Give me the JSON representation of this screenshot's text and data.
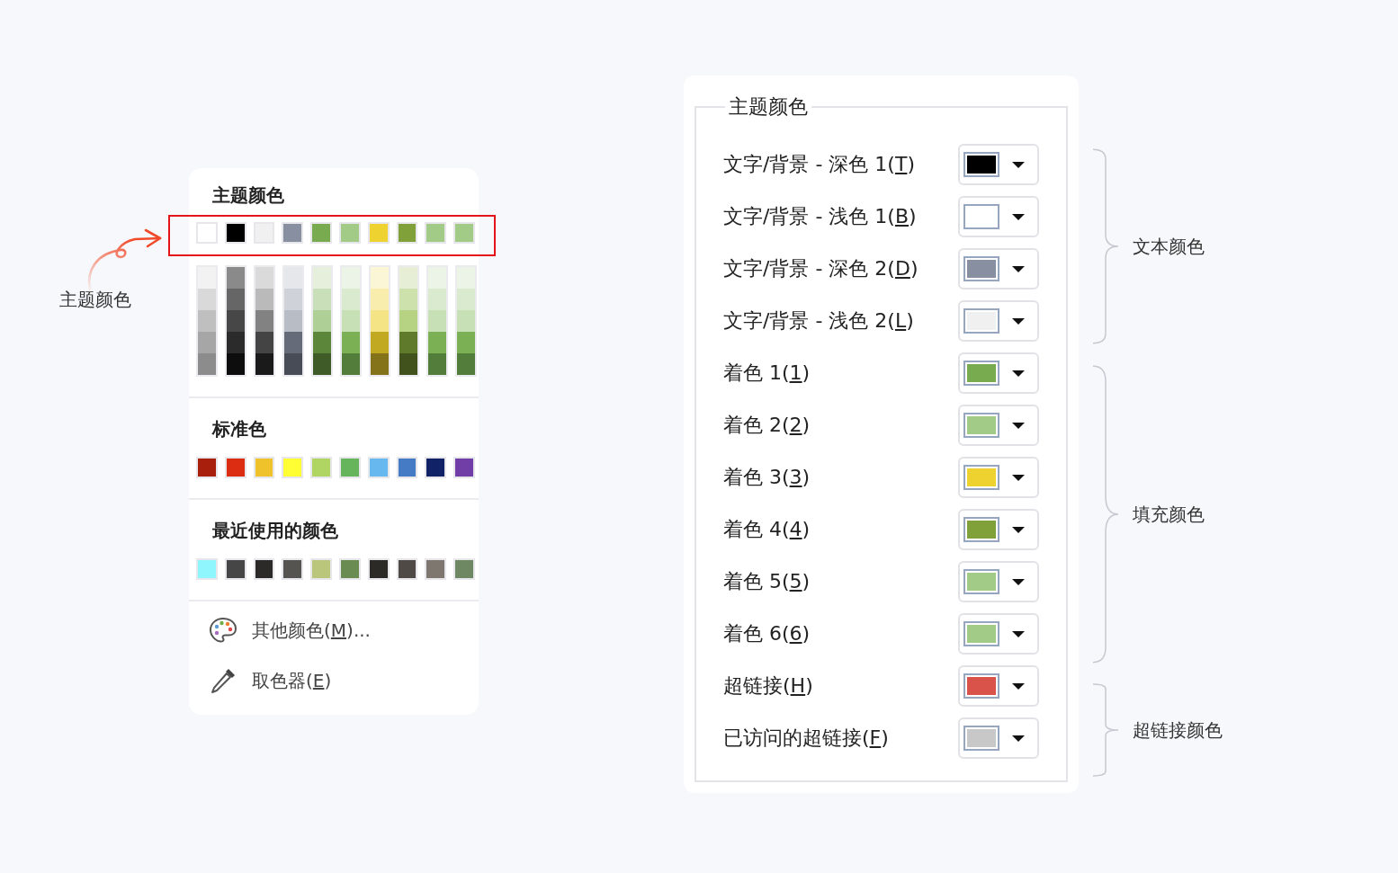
{
  "annotation": {
    "label": "主题颜色"
  },
  "color_menu": {
    "theme": {
      "title": "主题颜色",
      "highlighted": true,
      "swatches": [
        {
          "color": "#ffffff"
        },
        {
          "color": "#000000"
        },
        {
          "color": "#f0f0f0"
        },
        {
          "color": "#878fa0"
        },
        {
          "color": "#78ab50"
        },
        {
          "color": "#a1cb86"
        },
        {
          "color": "#eed230"
        },
        {
          "color": "#80a03a"
        },
        {
          "color": "#a1cb86"
        },
        {
          "color": "#a1cb86"
        }
      ],
      "shades": [
        {
          "cells": [
            {
              "color": "#f2f2f2"
            },
            {
              "color": "#d9d9d9"
            },
            {
              "color": "#bfbfbf"
            },
            {
              "color": "#a6a6a6"
            },
            {
              "color": "#8c8c8c"
            }
          ]
        },
        {
          "cells": [
            {
              "color": "#8a8a8a"
            },
            {
              "color": "#666666"
            },
            {
              "color": "#474747"
            },
            {
              "color": "#2b2b2b"
            },
            {
              "color": "#0d0d0d"
            }
          ]
        },
        {
          "cells": [
            {
              "color": "#dadada"
            },
            {
              "color": "#bababa"
            },
            {
              "color": "#828282"
            },
            {
              "color": "#444444"
            },
            {
              "color": "#1a1a1a"
            }
          ]
        },
        {
          "cells": [
            {
              "color": "#e6e7ea"
            },
            {
              "color": "#cfd2d8"
            },
            {
              "color": "#b8bcc5"
            },
            {
              "color": "#656b78"
            },
            {
              "color": "#484c57"
            }
          ]
        },
        {
          "cells": [
            {
              "color": "#e5efdc"
            },
            {
              "color": "#c9dfb9"
            },
            {
              "color": "#aed096"
            },
            {
              "color": "#5c873b"
            },
            {
              "color": "#3e5b28"
            }
          ]
        },
        {
          "cells": [
            {
              "color": "#ecf4e7"
            },
            {
              "color": "#d9eacf"
            },
            {
              "color": "#c7e0b6"
            },
            {
              "color": "#7cb055"
            },
            {
              "color": "#527d3a"
            }
          ]
        },
        {
          "cells": [
            {
              "color": "#fbf6d6"
            },
            {
              "color": "#f8edad"
            },
            {
              "color": "#f5e485"
            },
            {
              "color": "#c2a922"
            },
            {
              "color": "#85731a"
            }
          ]
        },
        {
          "cells": [
            {
              "color": "#e6efd6"
            },
            {
              "color": "#cde1ad"
            },
            {
              "color": "#b5d383"
            },
            {
              "color": "#607a2c"
            },
            {
              "color": "#41521d"
            }
          ]
        },
        {
          "cells": [
            {
              "color": "#ecf4e7"
            },
            {
              "color": "#d9eacf"
            },
            {
              "color": "#c7e0b6"
            },
            {
              "color": "#7cb055"
            },
            {
              "color": "#527d3a"
            }
          ]
        },
        {
          "cells": [
            {
              "color": "#ecf4e7"
            },
            {
              "color": "#d9eacf"
            },
            {
              "color": "#c7e0b6"
            },
            {
              "color": "#7cb055"
            },
            {
              "color": "#527d3a"
            }
          ]
        }
      ]
    },
    "standard": {
      "title": "标准色",
      "swatches": [
        {
          "color": "#a81f0c"
        },
        {
          "color": "#dc2d12"
        },
        {
          "color": "#efc22b"
        },
        {
          "color": "#fffd33"
        },
        {
          "color": "#b0d562"
        },
        {
          "color": "#66b55c"
        },
        {
          "color": "#66b8ee"
        },
        {
          "color": "#457bc4"
        },
        {
          "color": "#112366"
        },
        {
          "color": "#713da6"
        }
      ]
    },
    "recent": {
      "title": "最近使用的颜色",
      "swatches": [
        {
          "color": "#8ff6fe"
        },
        {
          "color": "#474646"
        },
        {
          "color": "#2b2a28"
        },
        {
          "color": "#565451"
        },
        {
          "color": "#bbc67d"
        },
        {
          "color": "#6a8b51"
        },
        {
          "color": "#2c2a27"
        },
        {
          "color": "#4f4a46"
        },
        {
          "color": "#7e7770"
        },
        {
          "color": "#6e8863"
        }
      ]
    },
    "actions": [
      {
        "kind": "palette",
        "label": "其他颜色(M)..."
      },
      {
        "kind": "eyedropper",
        "label": "取色器(E)"
      }
    ]
  },
  "theme_panel": {
    "legend": "主题颜色",
    "groups": [
      {
        "label": "文本颜色",
        "rows": [
          {
            "label": "文字/背景 - 深色 1(T)",
            "color": "#000000"
          },
          {
            "label": "文字/背景 - 浅色 1(B)",
            "color": "#ffffff"
          },
          {
            "label": "文字/背景 - 深色 2(D)",
            "color": "#878fa0"
          },
          {
            "label": "文字/背景 - 浅色 2(L)",
            "color": "#f0f0f0"
          }
        ]
      },
      {
        "label": "填充颜色",
        "rows": [
          {
            "label": "着色 1(1)",
            "color": "#78ab50"
          },
          {
            "label": "着色 2(2)",
            "color": "#a1cb86"
          },
          {
            "label": "着色 3(3)",
            "color": "#eed230"
          },
          {
            "label": "着色 4(4)",
            "color": "#80a03a"
          },
          {
            "label": "着色 5(5)",
            "color": "#a1cb86"
          },
          {
            "label": "着色 6(6)",
            "color": "#a1cb86"
          }
        ]
      },
      {
        "label": "超链接颜色",
        "rows": [
          {
            "label": "超链接(H)",
            "color": "#d9534a"
          },
          {
            "label": "已访问的超链接(F)",
            "color": "#c8c8c8"
          }
        ]
      }
    ]
  }
}
